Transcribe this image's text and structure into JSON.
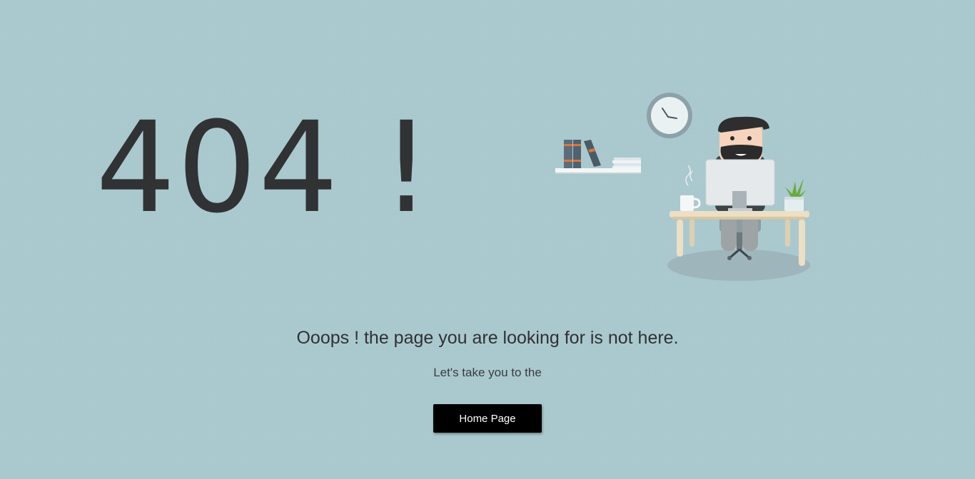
{
  "error": {
    "code_text": "404 !"
  },
  "message": {
    "headline": "Ooops ! the page you are looking for is not here.",
    "subline": "Let's take you to the"
  },
  "actions": {
    "home_label": "Home Page"
  },
  "colors": {
    "background": "#a9c8cd",
    "text": "#303234",
    "button_bg": "#000000",
    "button_text": "#ffffff"
  },
  "illustration": {
    "icons": [
      "clock-icon",
      "books-icon",
      "bookshelf-icon",
      "office-worker-icon",
      "monitor-icon",
      "coffee-mug-icon",
      "plant-icon",
      "desk-icon",
      "chair-icon"
    ]
  }
}
